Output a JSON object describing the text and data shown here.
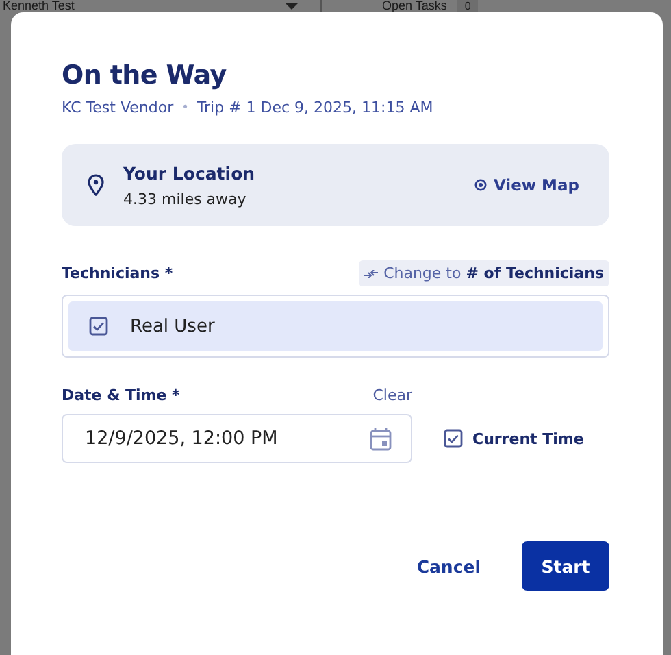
{
  "background": {
    "user_select": "Kenneth Test",
    "open_tasks": {
      "label": "Open Tasks",
      "count": "0"
    }
  },
  "dialog": {
    "title": "On the Way",
    "vendor": "KC Test Vendor",
    "separator": "•",
    "trip": "Trip # 1 Dec 9, 2025, 11:15 AM",
    "location": {
      "title": "Your Location",
      "distance": "4.33 miles away",
      "action": "View Map"
    },
    "technicians": {
      "label": "Technicians *",
      "toggle": "Change to **# of Technicians**",
      "items": [
        {
          "name": "Real User",
          "checked": true
        }
      ]
    },
    "date_time": {
      "label": "Date & Time *",
      "clear": "Clear",
      "value": "12/9/2025, 12:00 PM",
      "current_time": {
        "label": "Current Time",
        "checked": true
      }
    },
    "buttons": [
      {
        "label": "Cancel",
        "kind": "text"
      },
      {
        "label": "Start",
        "kind": "primary"
      }
    ]
  }
}
